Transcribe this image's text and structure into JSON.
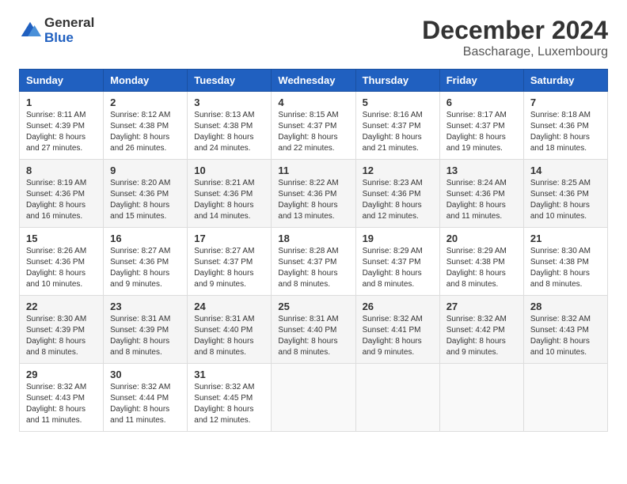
{
  "logo": {
    "general": "General",
    "blue": "Blue"
  },
  "title": "December 2024",
  "location": "Bascharage, Luxembourg",
  "days_of_week": [
    "Sunday",
    "Monday",
    "Tuesday",
    "Wednesday",
    "Thursday",
    "Friday",
    "Saturday"
  ],
  "weeks": [
    [
      {
        "day": "1",
        "sunrise": "8:11 AM",
        "sunset": "4:39 PM",
        "daylight": "8 hours and 27 minutes."
      },
      {
        "day": "2",
        "sunrise": "8:12 AM",
        "sunset": "4:38 PM",
        "daylight": "8 hours and 26 minutes."
      },
      {
        "day": "3",
        "sunrise": "8:13 AM",
        "sunset": "4:38 PM",
        "daylight": "8 hours and 24 minutes."
      },
      {
        "day": "4",
        "sunrise": "8:15 AM",
        "sunset": "4:37 PM",
        "daylight": "8 hours and 22 minutes."
      },
      {
        "day": "5",
        "sunrise": "8:16 AM",
        "sunset": "4:37 PM",
        "daylight": "8 hours and 21 minutes."
      },
      {
        "day": "6",
        "sunrise": "8:17 AM",
        "sunset": "4:37 PM",
        "daylight": "8 hours and 19 minutes."
      },
      {
        "day": "7",
        "sunrise": "8:18 AM",
        "sunset": "4:36 PM",
        "daylight": "8 hours and 18 minutes."
      }
    ],
    [
      {
        "day": "8",
        "sunrise": "8:19 AM",
        "sunset": "4:36 PM",
        "daylight": "8 hours and 16 minutes."
      },
      {
        "day": "9",
        "sunrise": "8:20 AM",
        "sunset": "4:36 PM",
        "daylight": "8 hours and 15 minutes."
      },
      {
        "day": "10",
        "sunrise": "8:21 AM",
        "sunset": "4:36 PM",
        "daylight": "8 hours and 14 minutes."
      },
      {
        "day": "11",
        "sunrise": "8:22 AM",
        "sunset": "4:36 PM",
        "daylight": "8 hours and 13 minutes."
      },
      {
        "day": "12",
        "sunrise": "8:23 AM",
        "sunset": "4:36 PM",
        "daylight": "8 hours and 12 minutes."
      },
      {
        "day": "13",
        "sunrise": "8:24 AM",
        "sunset": "4:36 PM",
        "daylight": "8 hours and 11 minutes."
      },
      {
        "day": "14",
        "sunrise": "8:25 AM",
        "sunset": "4:36 PM",
        "daylight": "8 hours and 10 minutes."
      }
    ],
    [
      {
        "day": "15",
        "sunrise": "8:26 AM",
        "sunset": "4:36 PM",
        "daylight": "8 hours and 10 minutes."
      },
      {
        "day": "16",
        "sunrise": "8:27 AM",
        "sunset": "4:36 PM",
        "daylight": "8 hours and 9 minutes."
      },
      {
        "day": "17",
        "sunrise": "8:27 AM",
        "sunset": "4:37 PM",
        "daylight": "8 hours and 9 minutes."
      },
      {
        "day": "18",
        "sunrise": "8:28 AM",
        "sunset": "4:37 PM",
        "daylight": "8 hours and 8 minutes."
      },
      {
        "day": "19",
        "sunrise": "8:29 AM",
        "sunset": "4:37 PM",
        "daylight": "8 hours and 8 minutes."
      },
      {
        "day": "20",
        "sunrise": "8:29 AM",
        "sunset": "4:38 PM",
        "daylight": "8 hours and 8 minutes."
      },
      {
        "day": "21",
        "sunrise": "8:30 AM",
        "sunset": "4:38 PM",
        "daylight": "8 hours and 8 minutes."
      }
    ],
    [
      {
        "day": "22",
        "sunrise": "8:30 AM",
        "sunset": "4:39 PM",
        "daylight": "8 hours and 8 minutes."
      },
      {
        "day": "23",
        "sunrise": "8:31 AM",
        "sunset": "4:39 PM",
        "daylight": "8 hours and 8 minutes."
      },
      {
        "day": "24",
        "sunrise": "8:31 AM",
        "sunset": "4:40 PM",
        "daylight": "8 hours and 8 minutes."
      },
      {
        "day": "25",
        "sunrise": "8:31 AM",
        "sunset": "4:40 PM",
        "daylight": "8 hours and 8 minutes."
      },
      {
        "day": "26",
        "sunrise": "8:32 AM",
        "sunset": "4:41 PM",
        "daylight": "8 hours and 9 minutes."
      },
      {
        "day": "27",
        "sunrise": "8:32 AM",
        "sunset": "4:42 PM",
        "daylight": "8 hours and 9 minutes."
      },
      {
        "day": "28",
        "sunrise": "8:32 AM",
        "sunset": "4:43 PM",
        "daylight": "8 hours and 10 minutes."
      }
    ],
    [
      {
        "day": "29",
        "sunrise": "8:32 AM",
        "sunset": "4:43 PM",
        "daylight": "8 hours and 11 minutes."
      },
      {
        "day": "30",
        "sunrise": "8:32 AM",
        "sunset": "4:44 PM",
        "daylight": "8 hours and 11 minutes."
      },
      {
        "day": "31",
        "sunrise": "8:32 AM",
        "sunset": "4:45 PM",
        "daylight": "8 hours and 12 minutes."
      },
      null,
      null,
      null,
      null
    ]
  ],
  "labels": {
    "sunrise_prefix": "Sunrise: ",
    "sunset_prefix": "Sunset: ",
    "daylight_label": "Daylight: "
  }
}
